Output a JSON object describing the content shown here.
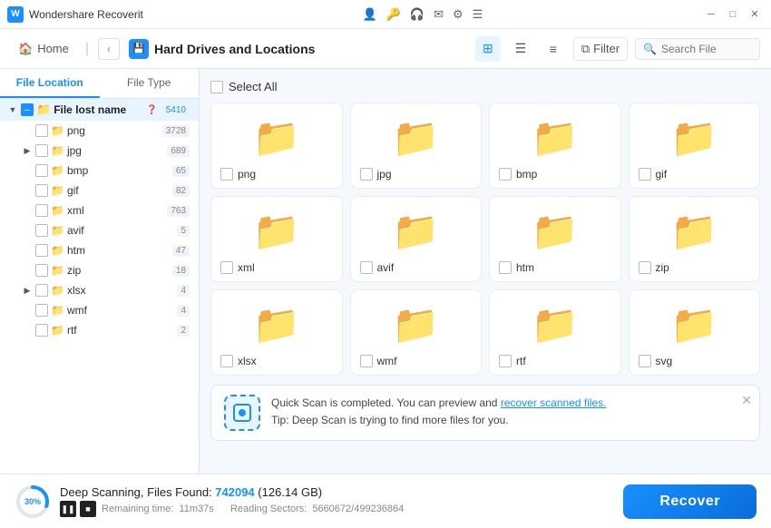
{
  "app": {
    "name": "Wondershare Recoverit",
    "logo": "W"
  },
  "titlebar": {
    "icons": [
      "user-icon",
      "key-icon",
      "headset-icon",
      "mail-icon",
      "gear-icon",
      "menu-icon"
    ],
    "controls": [
      "minimize",
      "maximize",
      "close"
    ]
  },
  "nav": {
    "home_label": "Home",
    "back_label": "‹",
    "section_label": "Hard Drives and Locations",
    "view_grid": "⊞",
    "view_list": "☰",
    "view_detail": "≡",
    "filter_label": "Filter",
    "search_placeholder": "Search File"
  },
  "sidebar": {
    "tab_location": "File Location",
    "tab_type": "File Type",
    "tree": {
      "root_label": "File lost name",
      "root_badge": "5410",
      "children": [
        {
          "label": "png",
          "count": "3728",
          "indent": 1,
          "expandable": false
        },
        {
          "label": "jpg",
          "count": "689",
          "indent": 1,
          "expandable": true
        },
        {
          "label": "bmp",
          "count": "65",
          "indent": 1,
          "expandable": false
        },
        {
          "label": "gif",
          "count": "82",
          "indent": 1,
          "expandable": false
        },
        {
          "label": "xml",
          "count": "763",
          "indent": 1,
          "expandable": false
        },
        {
          "label": "avif",
          "count": "5",
          "indent": 1,
          "expandable": false
        },
        {
          "label": "htm",
          "count": "47",
          "indent": 1,
          "expandable": false
        },
        {
          "label": "zip",
          "count": "18",
          "indent": 1,
          "expandable": false
        },
        {
          "label": "xlsx",
          "count": "4",
          "indent": 1,
          "expandable": true
        },
        {
          "label": "wmf",
          "count": "4",
          "indent": 1,
          "expandable": false
        },
        {
          "label": "rtf",
          "count": "2",
          "indent": 1,
          "expandable": false
        }
      ]
    }
  },
  "grid": {
    "select_all": "Select All",
    "folders": [
      {
        "name": "png"
      },
      {
        "name": "jpg"
      },
      {
        "name": "bmp"
      },
      {
        "name": "gif"
      },
      {
        "name": "xml"
      },
      {
        "name": "avif"
      },
      {
        "name": "htm"
      },
      {
        "name": "zip"
      },
      {
        "name": "xlsx"
      },
      {
        "name": "wmf"
      },
      {
        "name": "rtf"
      },
      {
        "name": "svg"
      }
    ]
  },
  "notification": {
    "text_before": "Quick Scan is completed. You can preview and ",
    "link_text": "recover scanned files.",
    "tip": "Tip: Deep Scan is trying to find more files for you."
  },
  "bottombar": {
    "progress_pct": "30%",
    "progress_num": 30,
    "scan_title_before": "Deep Scanning, Files Found: ",
    "scan_files_count": "742094",
    "scan_size": "(126.14 GB)",
    "remaining_label": "Remaining time:",
    "remaining_value": "11m37s",
    "reading_label": "Reading Sectors:",
    "reading_value": "5660672/499236864",
    "recover_label": "Recover"
  },
  "colors": {
    "accent": "#1890ff",
    "folder": "#f5a623"
  }
}
